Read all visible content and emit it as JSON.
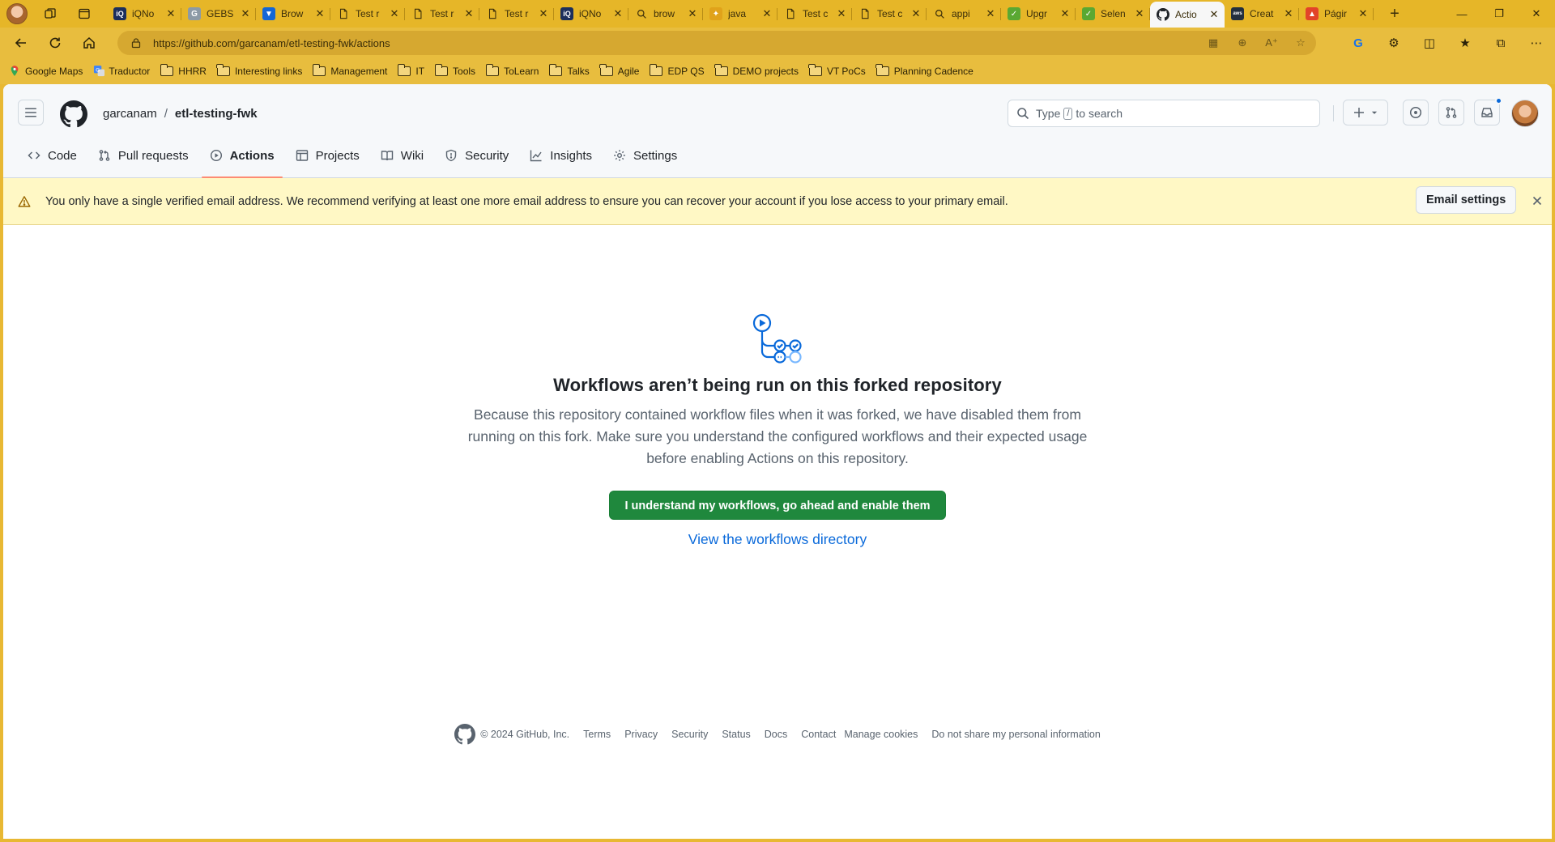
{
  "browser": {
    "tabs": [
      {
        "label": "iQNo",
        "color": "#1c2f5c",
        "glyph": "iQ"
      },
      {
        "label": "GEBS",
        "color": "#8c9aa6",
        "glyph": "G"
      },
      {
        "label": "Brow",
        "color": "#1366d6",
        "glyph": "▼"
      },
      {
        "label": "Test r",
        "color": "none",
        "glyph": "doc"
      },
      {
        "label": "Test r",
        "color": "none",
        "glyph": "doc"
      },
      {
        "label": "Test r",
        "color": "none",
        "glyph": "doc"
      },
      {
        "label": "iQNo",
        "color": "#1c2f5c",
        "glyph": "iQ"
      },
      {
        "label": "brow",
        "color": "none",
        "glyph": "search"
      },
      {
        "label": "java",
        "color": "#e0a21a",
        "glyph": "✦"
      },
      {
        "label": "Test c",
        "color": "none",
        "glyph": "doc"
      },
      {
        "label": "Test c",
        "color": "none",
        "glyph": "doc"
      },
      {
        "label": "appi",
        "color": "none",
        "glyph": "search"
      },
      {
        "label": "Upgr",
        "color": "#5aa832",
        "glyph": "✓"
      },
      {
        "label": "Selen",
        "color": "#5aa832",
        "glyph": "✓"
      },
      {
        "label": "Actio",
        "color": "#1f2328",
        "glyph": "gh",
        "active": true
      },
      {
        "label": "Creat",
        "color": "#232f3e",
        "glyph": "aws"
      },
      {
        "label": "Págir",
        "color": "#e24329",
        "glyph": "▲"
      }
    ],
    "url": "https://github.com/garcanam/etl-testing-fwk/actions",
    "bookmarks": [
      {
        "label": "Google Maps",
        "icon": "map-pin-icon"
      },
      {
        "label": "Traductor",
        "icon": "translate-icon"
      },
      {
        "label": "HHRR",
        "icon": "folder-icon"
      },
      {
        "label": "Interesting links",
        "icon": "folder-icon"
      },
      {
        "label": "Management",
        "icon": "folder-icon"
      },
      {
        "label": "IT",
        "icon": "folder-icon"
      },
      {
        "label": "Tools",
        "icon": "folder-icon"
      },
      {
        "label": "ToLearn",
        "icon": "folder-icon"
      },
      {
        "label": "Talks",
        "icon": "folder-icon"
      },
      {
        "label": "Agile",
        "icon": "folder-icon"
      },
      {
        "label": "EDP QS",
        "icon": "folder-icon"
      },
      {
        "label": "DEMO projects",
        "icon": "folder-icon"
      },
      {
        "label": "VT PoCs",
        "icon": "folder-icon"
      },
      {
        "label": "Planning Cadence",
        "icon": "folder-icon"
      }
    ]
  },
  "header": {
    "owner": "garcanam",
    "separator": "/",
    "repo": "etl-testing-fwk",
    "search_prefix": "Type",
    "search_key": "/",
    "search_suffix": "to search"
  },
  "repo_nav": [
    {
      "label": "Code",
      "icon": "code-icon"
    },
    {
      "label": "Pull requests",
      "icon": "pull-request-icon"
    },
    {
      "label": "Actions",
      "icon": "play-icon",
      "active": true
    },
    {
      "label": "Projects",
      "icon": "table-icon"
    },
    {
      "label": "Wiki",
      "icon": "book-icon"
    },
    {
      "label": "Security",
      "icon": "shield-icon"
    },
    {
      "label": "Insights",
      "icon": "graph-icon"
    },
    {
      "label": "Settings",
      "icon": "gear-icon"
    }
  ],
  "flash": {
    "message": "You only have a single verified email address. We recommend verifying at least one more email address to ensure you can recover your account if you lose access to your primary email.",
    "button": "Email settings"
  },
  "blankslate": {
    "title": "Workflows aren’t being run on this forked repository",
    "description": "Because this repository contained workflow files when it was forked, we have disabled them from running on this fork. Make sure you understand the configured workflows and their expected usage before enabling Actions on this repository.",
    "primary_button": "I understand my workflows, go ahead and enable them",
    "link": "View the workflows directory"
  },
  "footer": {
    "copyright": "© 2024 GitHub, Inc.",
    "links": [
      "Terms",
      "Privacy",
      "Security",
      "Status",
      "Docs",
      "Contact",
      "Manage cookies",
      "Do not share my personal information"
    ]
  },
  "colors": {
    "browser_theme": "#e8b833",
    "flash_bg": "#fff8c5",
    "primary_green": "#1f883d",
    "link_blue": "#0969da",
    "active_underline": "#fd8c73"
  }
}
